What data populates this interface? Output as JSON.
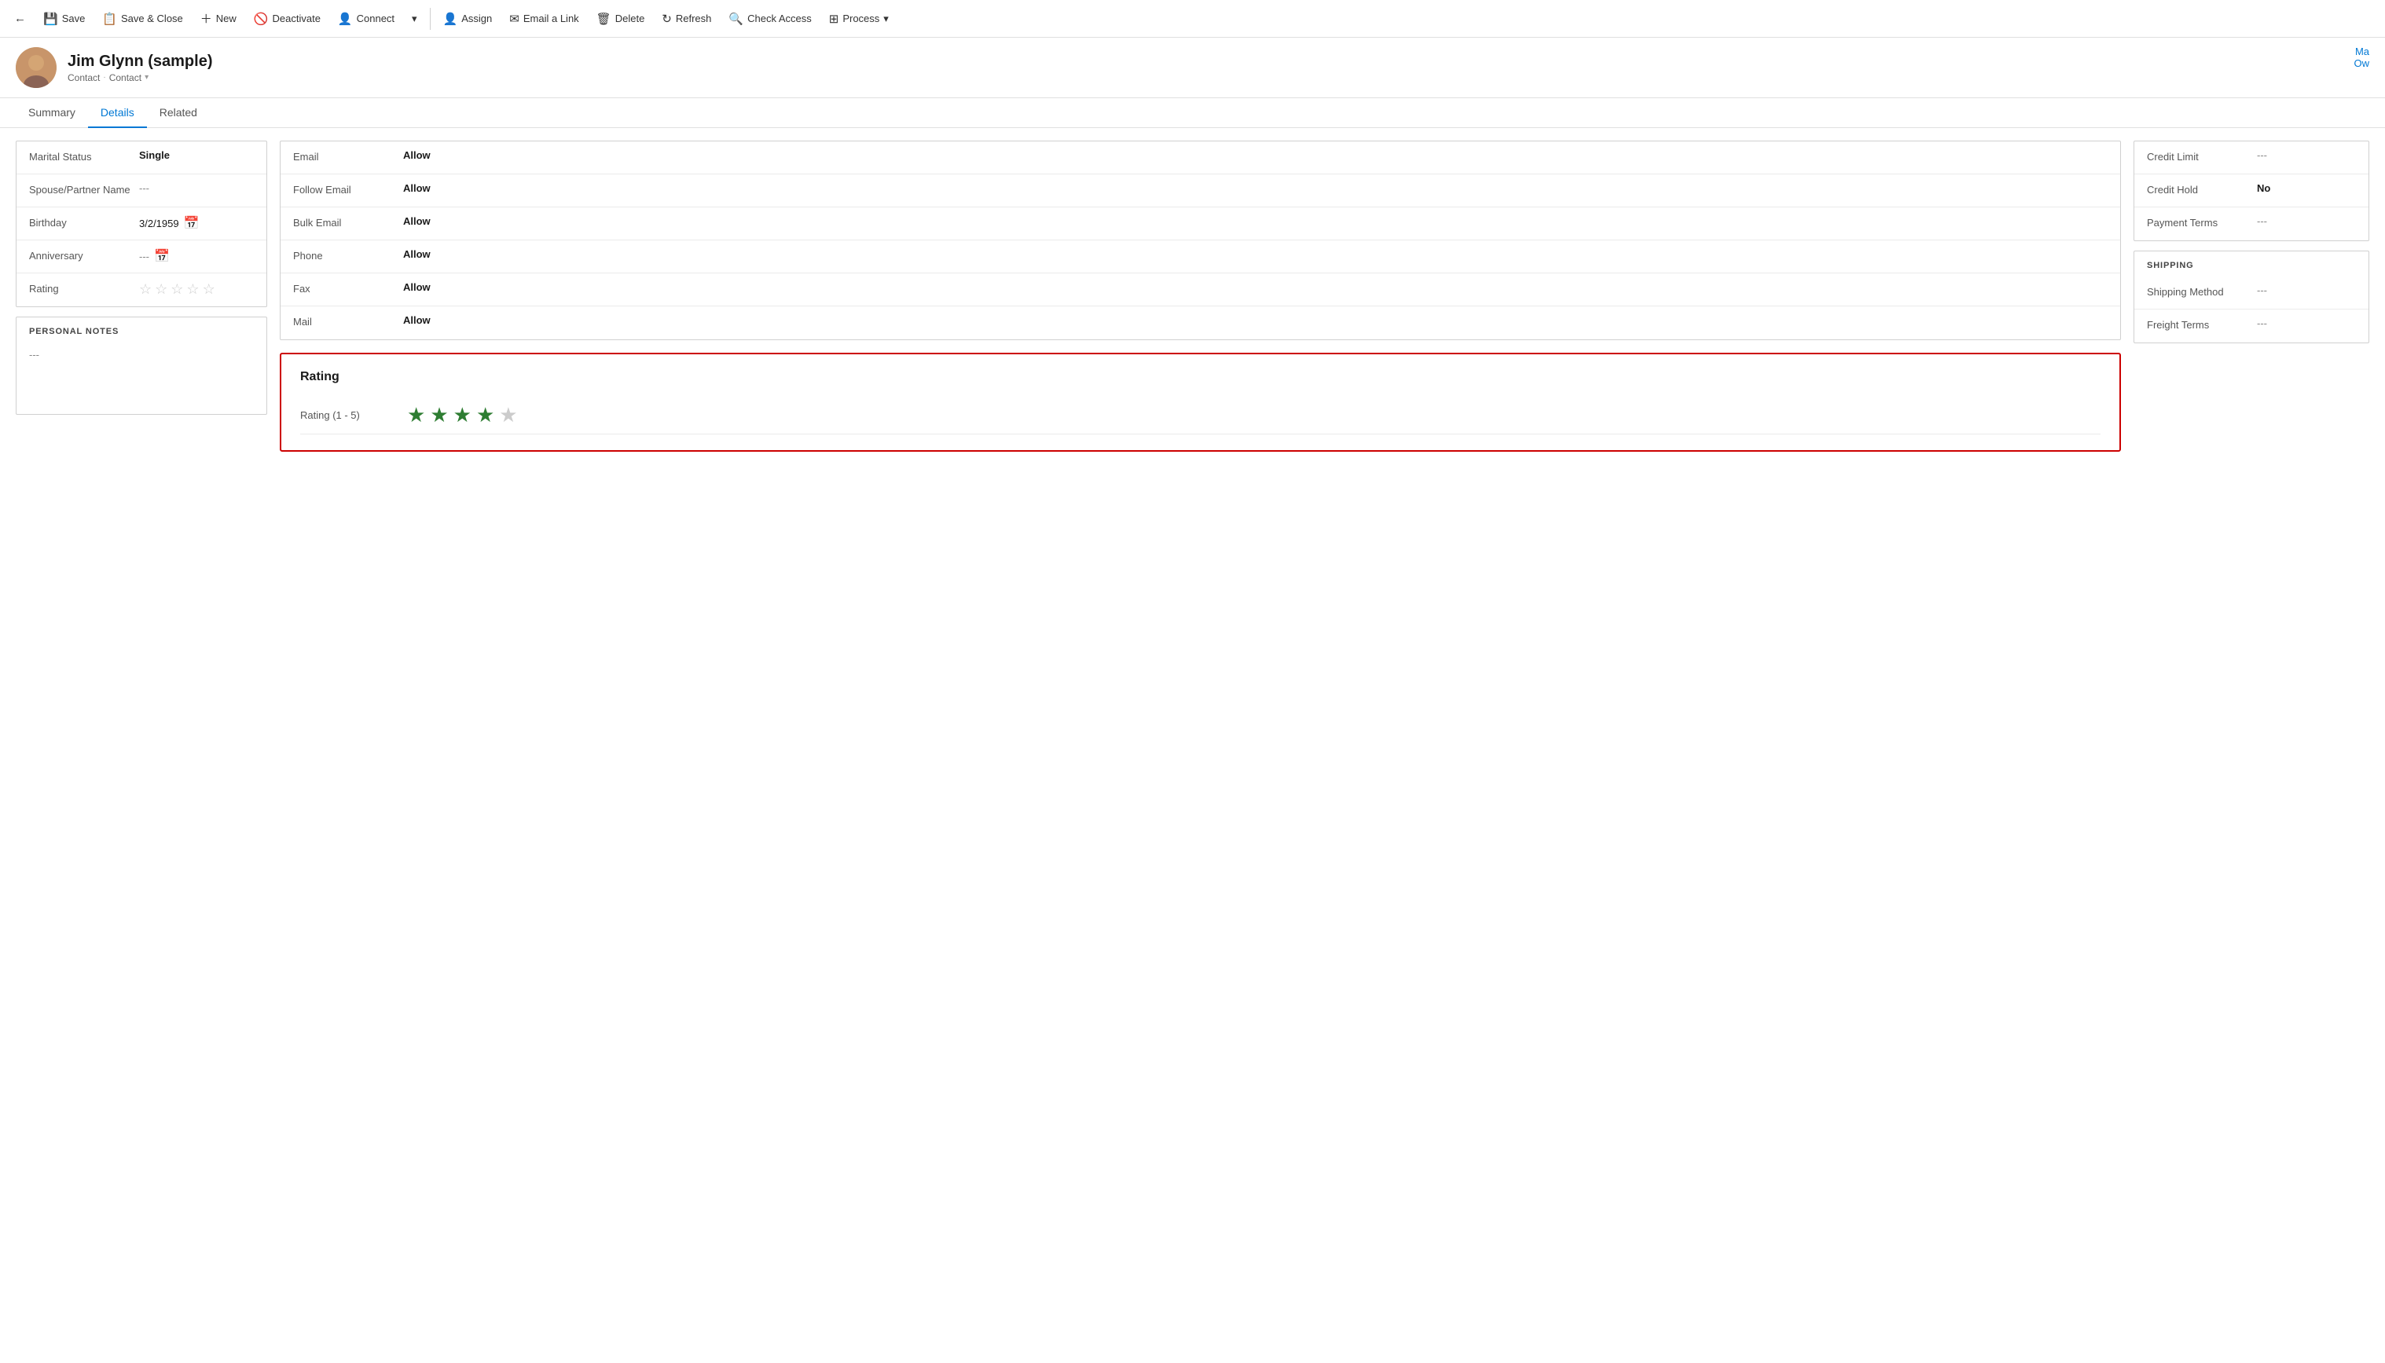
{
  "toolbar": {
    "back_icon": "←",
    "save_label": "Save",
    "save_close_label": "Save & Close",
    "new_label": "New",
    "deactivate_label": "Deactivate",
    "connect_label": "Connect",
    "more_icon": "▾",
    "assign_label": "Assign",
    "email_link_label": "Email a Link",
    "delete_label": "Delete",
    "refresh_label": "Refresh",
    "check_access_label": "Check Access",
    "process_label": "Process",
    "process_more_icon": "▾"
  },
  "header": {
    "name": "Jim Glynn (sample)",
    "breadcrumb1": "Contact",
    "breadcrumb2": "Contact",
    "ma_label": "Ma",
    "ow_label": "Ow"
  },
  "tabs": [
    {
      "label": "Summary",
      "active": false
    },
    {
      "label": "Details",
      "active": true
    },
    {
      "label": "Related",
      "active": false
    }
  ],
  "left_section": {
    "fields": [
      {
        "label": "Marital Status",
        "value": "Single",
        "type": "text",
        "bold": true
      },
      {
        "label": "Spouse/Partner Name",
        "value": "---",
        "type": "empty"
      },
      {
        "label": "Birthday",
        "value": "3/2/1959",
        "type": "date"
      },
      {
        "label": "Anniversary",
        "value": "---",
        "type": "date-empty"
      },
      {
        "label": "Rating",
        "value": "",
        "type": "stars",
        "filled": 0,
        "total": 5
      }
    ]
  },
  "personal_notes": {
    "title": "PERSONAL NOTES",
    "value": "---"
  },
  "middle_section": {
    "fields": [
      {
        "label": "Email",
        "value": "Allow",
        "bold": true
      },
      {
        "label": "Follow Email",
        "value": "Allow",
        "bold": true
      },
      {
        "label": "Bulk Email",
        "value": "Allow",
        "bold": true
      },
      {
        "label": "Phone",
        "value": "Allow",
        "bold": true
      },
      {
        "label": "Fax",
        "value": "Allow",
        "bold": true
      },
      {
        "label": "Mail",
        "value": "Allow",
        "bold": true
      }
    ]
  },
  "rating_popup": {
    "title": "Rating",
    "row_label": "Rating (1 - 5)",
    "filled_stars": 4,
    "total_stars": 5
  },
  "right_section": {
    "fields": [
      {
        "label": "Credit Limit",
        "value": "---",
        "type": "empty"
      },
      {
        "label": "Credit Hold",
        "value": "No",
        "bold": true
      },
      {
        "label": "Payment Terms",
        "value": "---",
        "type": "empty"
      }
    ],
    "shipping_title": "SHIPPING",
    "shipping_fields": [
      {
        "label": "Shipping Method",
        "value": "---",
        "type": "empty"
      },
      {
        "label": "Freight Terms",
        "value": "---",
        "type": "empty"
      }
    ]
  }
}
